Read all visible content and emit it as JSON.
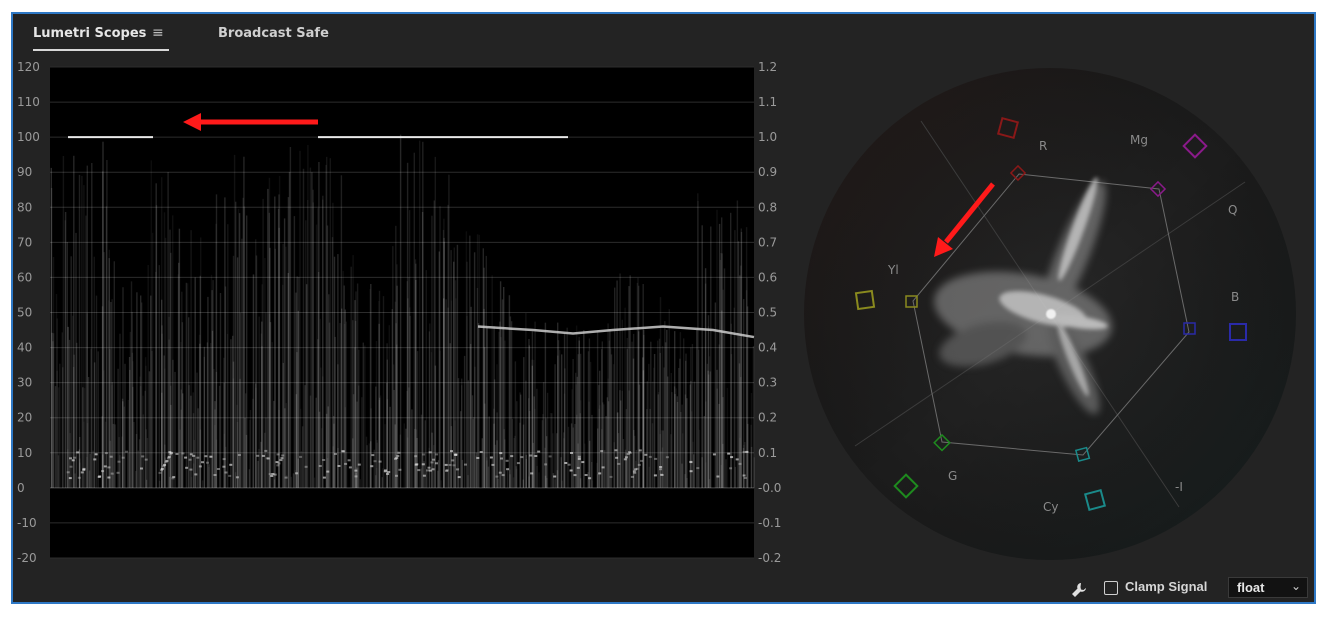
{
  "tabs": [
    {
      "label": "Lumetri Scopes",
      "active": true
    },
    {
      "label": "Broadcast Safe",
      "active": false
    }
  ],
  "icons": {
    "menu": "hamburger-menu-icon",
    "wrench": "wrench-icon",
    "chevron": "chevron-down-icon"
  },
  "waveform": {
    "left_axis_ticks": [
      "120",
      "110",
      "100",
      "90",
      "80",
      "70",
      "60",
      "50",
      "40",
      "30",
      "20",
      "10",
      "0",
      "-10",
      "-20"
    ],
    "right_axis_ticks": [
      "1.2",
      "1.1",
      "1.0",
      "0.9",
      "0.8",
      "0.7",
      "0.6",
      "0.5",
      "0.4",
      "0.3",
      "0.2",
      "0.1",
      "-0.0",
      "-0.1",
      "-0.2"
    ],
    "range": [
      -20,
      120
    ]
  },
  "vectorscope": {
    "labels": [
      "R",
      "Mg",
      "Q",
      "B",
      "-I",
      "Cy",
      "G",
      "Yl"
    ],
    "colors": {
      "R": "#a01a1a",
      "Mg": "#a01aa0",
      "B": "#2a2ab0",
      "Cy": "#1a9a9a",
      "G": "#1e9a1e",
      "Yl": "#a0a020"
    }
  },
  "annotations": {
    "arrow_color": "#ff1a1a"
  },
  "bottom_bar": {
    "clamp_label": "Clamp Signal",
    "clamp_checked": false,
    "format_value": "float"
  },
  "colors": {
    "border": "#2e78c5",
    "panel_bg": "#232323"
  }
}
